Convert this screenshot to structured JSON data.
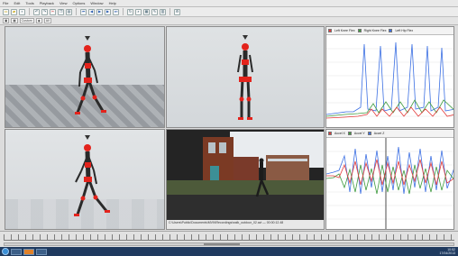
{
  "menu": [
    "File",
    "Edit",
    "Tools",
    "Playback",
    "View",
    "Options",
    "Window",
    "Help"
  ],
  "toolbar_icons": [
    "new-icon",
    "open-icon",
    "save-icon",
    "undo-icon",
    "redo-icon",
    "cut-icon",
    "copy-icon",
    "paste-icon",
    "first-frame-icon",
    "prev-frame-icon",
    "play-icon",
    "next-frame-icon",
    "last-frame-icon",
    "loop-icon",
    "zoom-icon",
    "grid-icon",
    "pen-icon",
    "chart-icon",
    "settings-icon"
  ],
  "toolbar2": {
    "fields": [
      "Custom",
      "All"
    ]
  },
  "graph_top": {
    "dropdown": "Body",
    "legend": [
      {
        "label": "Left Knee Flex",
        "color": "#e33b3b"
      },
      {
        "label": "Right Knee Flex",
        "color": "#3f9b3f"
      },
      {
        "label": "Left Hip Flex",
        "color": "#3b6fe3"
      }
    ]
  },
  "graph_bottom": {
    "legend": [
      {
        "label": "Accel X",
        "color": "#e33b3b"
      },
      {
        "label": "Accel Y",
        "color": "#3f9b3f"
      },
      {
        "label": "Accel Z",
        "color": "#3b6fe3"
      }
    ]
  },
  "video": {
    "caption": "C:\\Users\\Public\\Documents\\MVN\\Recordings\\walk_outdoor_02.avi  —  00:00:12.48"
  },
  "timeline": {
    "progress": 0.48
  },
  "taskbar": {
    "time": "10:52",
    "date": "17/04/2013"
  },
  "colors": {
    "joint_red": "#e3231c",
    "bone_dark": "#2a2a2a",
    "grid_line": "#d9d9d9"
  }
}
